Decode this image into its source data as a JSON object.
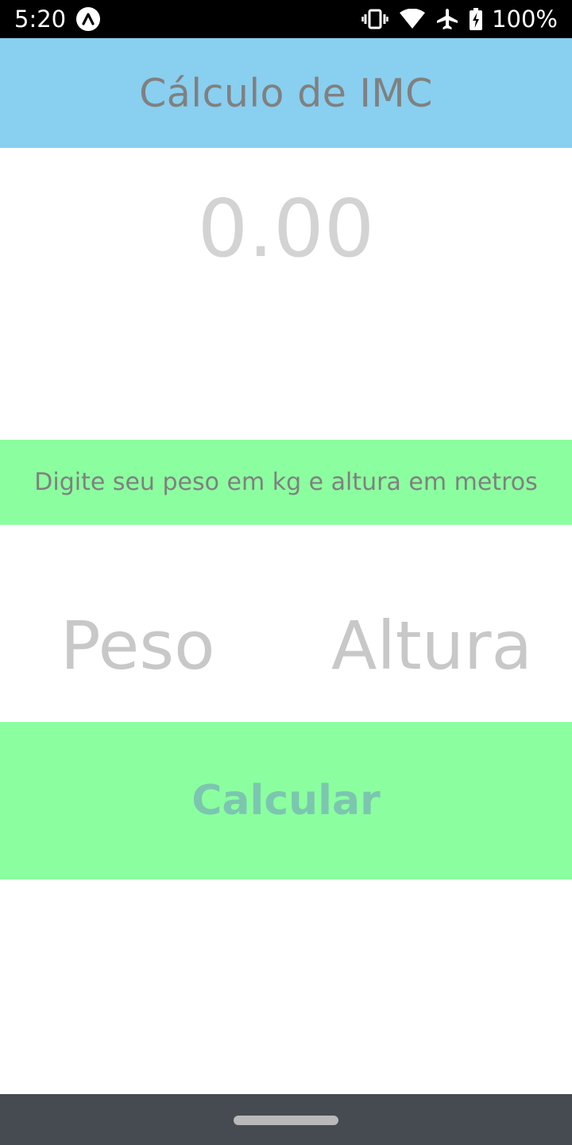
{
  "status_bar": {
    "time": "5:20",
    "battery": "100%",
    "icons": [
      "app-notification-icon",
      "vibrate-icon",
      "wifi-icon",
      "airplane-mode-icon",
      "battery-charging-icon"
    ]
  },
  "header": {
    "title": "Cálculo de IMC",
    "background_color": "#89cff0"
  },
  "result": {
    "value": "0.00"
  },
  "instruction": {
    "text": "Digite seu peso em kg e altura em metros",
    "background_color": "#8bff9f"
  },
  "form": {
    "peso_placeholder": "Peso",
    "altura_placeholder": "Altura",
    "peso_value": "",
    "altura_value": ""
  },
  "button": {
    "label": "Calcular",
    "background_color": "#8bff9f",
    "text_color": "#7cc6b0"
  },
  "nav_bar": {
    "background_color": "#464a51"
  }
}
